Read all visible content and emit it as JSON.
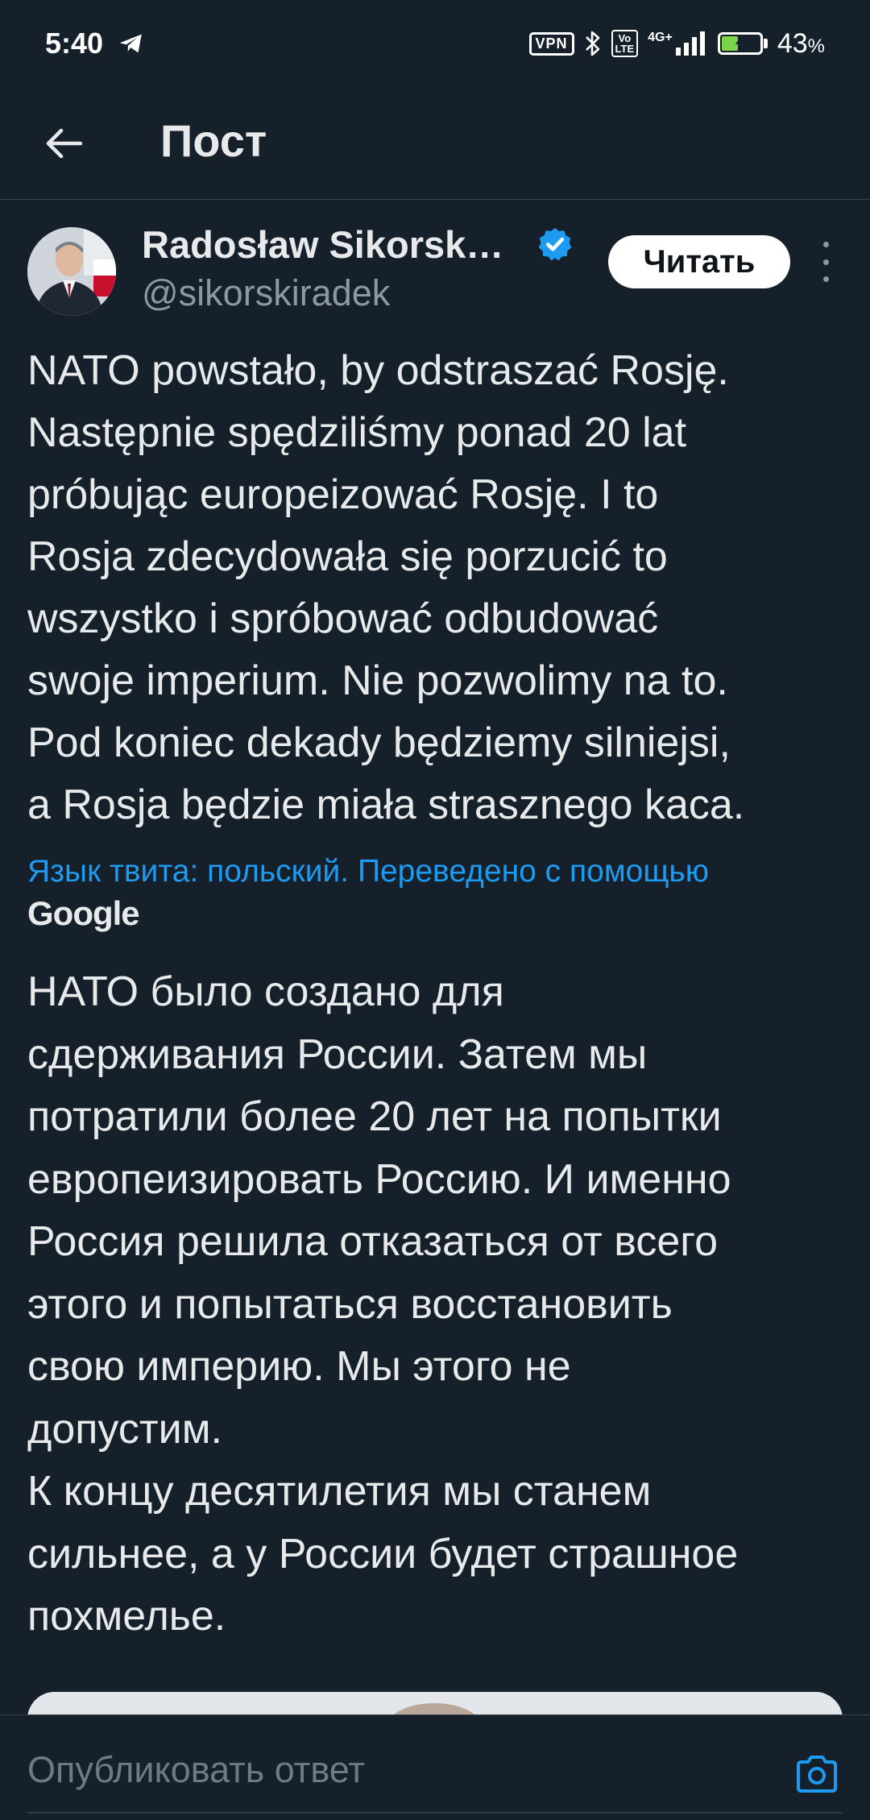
{
  "status_bar": {
    "time": "5:40",
    "vpn": "VPN",
    "volte": "Vo\nLTE",
    "network": "4G+",
    "battery_percent": "43",
    "battery_suffix": "%",
    "battery_level": 0.43,
    "colors": {
      "battery_fill": "#7bd44a"
    }
  },
  "header": {
    "back_icon": "arrow-left-icon",
    "title": "Пост"
  },
  "author": {
    "name": "Radosław Sikorsk…",
    "handle": "@sikorskiradek",
    "verified_icon": "verified-badge-icon",
    "follow_label": "Читать",
    "more_icon": "more-vertical-icon"
  },
  "tweet": {
    "original_text": "NATO powstało, by odstraszać Rosję.\nNastępnie spędziliśmy ponad 20 lat\npróbując europeizować Rosję. I to\nRosja zdecydowała się porzucić to\nwszystko i spróbować odbudować\nswoje imperium. Nie pozwolimy na to.\nPod koniec dekady będziemy silniejsi,\na Rosja będzie miała strasznego kaca.",
    "translation_meta": "Язык твита: польский. Переведено с помощью",
    "translation_provider": "Google",
    "translated_text": "НАТО было создано для\nсдерживания России. Затем мы\nпотратили более 20 лет на попытки\nевропеизировать Россию. И именно\nРоссия решила отказаться от всего\nэтого и попытаться восстановить\nсвою империю. Мы этого не\nдопустим.\nК концу десятилетия мы станем\nсильнее, а у России будет страшное\nпохмелье."
  },
  "reply": {
    "placeholder": "Опубликовать ответ",
    "camera_icon": "camera-icon"
  },
  "colors": {
    "background": "#15202b",
    "accent": "#1d9bf0",
    "text_primary": "#e7e9ea",
    "text_secondary": "#8b98a5"
  }
}
